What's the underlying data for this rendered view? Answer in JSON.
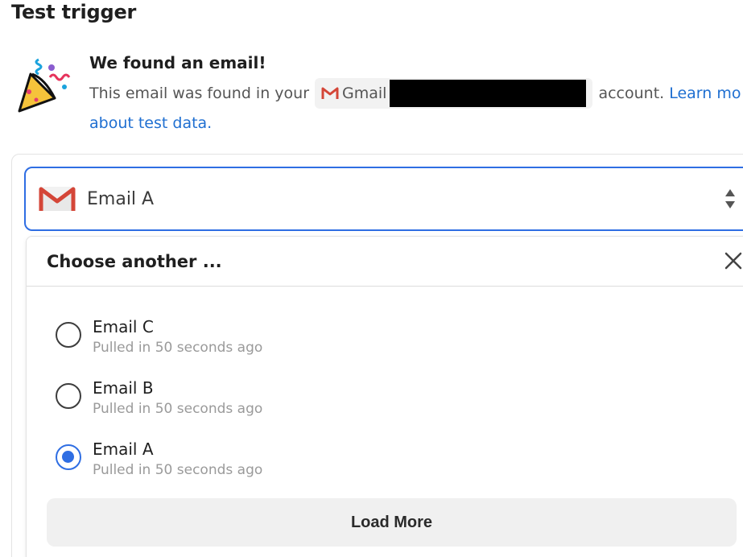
{
  "page": {
    "title": "Test trigger"
  },
  "found": {
    "heading": "We found an email!",
    "desc_before": "This email was found in your",
    "app_name": "Gmail",
    "desc_after": "account.",
    "learn_more_1": "Learn mo",
    "learn_more_2": "about test data."
  },
  "select": {
    "value": "Email A"
  },
  "dropdown": {
    "title": "Choose another ...",
    "options": [
      {
        "label": "Email C",
        "sub": "Pulled in 50 seconds ago",
        "checked": false
      },
      {
        "label": "Email B",
        "sub": "Pulled in 50 seconds ago",
        "checked": false
      },
      {
        "label": "Email A",
        "sub": "Pulled in 50 seconds ago",
        "checked": true
      }
    ],
    "load_more": "Load More"
  },
  "colors": {
    "accent": "#2f6ee3",
    "link": "#1f6fd1",
    "gmail_red": "#d44638"
  },
  "icons": [
    "party-popper-icon",
    "gmail-icon",
    "sort-arrows-icon",
    "close-icon",
    "radio-icon"
  ]
}
